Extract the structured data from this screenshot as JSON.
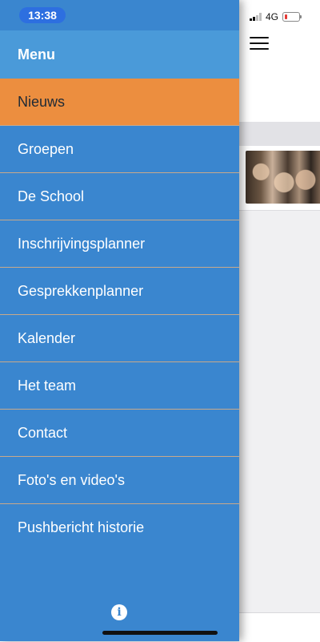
{
  "status_bar": {
    "time": "13:38",
    "network": "4G"
  },
  "drawer": {
    "title": "Menu",
    "items": [
      {
        "label": "Nieuws",
        "active": true
      },
      {
        "label": "Groepen"
      },
      {
        "label": "De School"
      },
      {
        "label": "Inschrijvingsplanner"
      },
      {
        "label": "Gesprekkenplanner"
      },
      {
        "label": "Kalender"
      },
      {
        "label": "Het team"
      },
      {
        "label": "Contact"
      },
      {
        "label": "Foto's en video's"
      },
      {
        "label": "Pushbericht historie"
      }
    ],
    "info_icon": "i"
  },
  "colors": {
    "drawer_bg": "#3a86cf",
    "header_bg": "#4a9ad9",
    "active_bg": "#ec8e3f"
  },
  "icons": [
    "hamburger-icon",
    "signal-icon",
    "battery-icon",
    "info-icon"
  ]
}
